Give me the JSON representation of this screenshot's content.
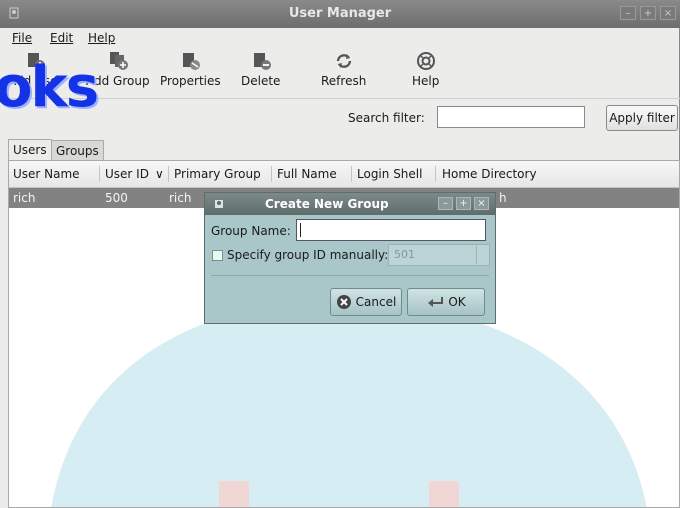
{
  "window": {
    "title": "User Manager",
    "controls": [
      "–",
      "+",
      "×"
    ]
  },
  "menubar": {
    "items": [
      {
        "label": "File"
      },
      {
        "label": "Edit"
      },
      {
        "label": "Help"
      }
    ]
  },
  "toolbar": {
    "items": [
      {
        "label": "Add User",
        "icon": "add-user-icon"
      },
      {
        "label": "Add Group",
        "icon": "add-group-icon"
      },
      {
        "label": "Properties",
        "icon": "properties-icon"
      },
      {
        "label": "Delete",
        "icon": "delete-icon"
      },
      {
        "label": "Refresh",
        "icon": "refresh-icon"
      },
      {
        "label": "Help",
        "icon": "help-icon"
      }
    ]
  },
  "overlay": {
    "text": "oks"
  },
  "search": {
    "label": "Search filter:",
    "value": "",
    "apply_label": "Apply filter"
  },
  "tabs": [
    {
      "label": "Users"
    },
    {
      "label": "Groups"
    }
  ],
  "table": {
    "columns": [
      "User Name",
      "User ID",
      "Primary Group",
      "Full Name",
      "Login Shell",
      "Home Directory"
    ],
    "sort_indicator": "∨",
    "rows": [
      {
        "user_name": "rich",
        "user_id": "500",
        "primary_group": "rich",
        "home_directory_tail": "h"
      }
    ]
  },
  "dialog": {
    "title": "Create New Group",
    "controls": [
      "–",
      "+",
      "×"
    ],
    "group_name_label": "Group Name:",
    "group_name_value": "",
    "specify_gid_label": "Specify group ID manually:",
    "specify_gid_checked": false,
    "gid_value": "501",
    "cancel_label": "Cancel",
    "ok_label": "OK"
  },
  "colors": {
    "selected_row": "#828282",
    "dialog_bg": "#a9c7c9",
    "overlay_text": "#1433e6"
  }
}
